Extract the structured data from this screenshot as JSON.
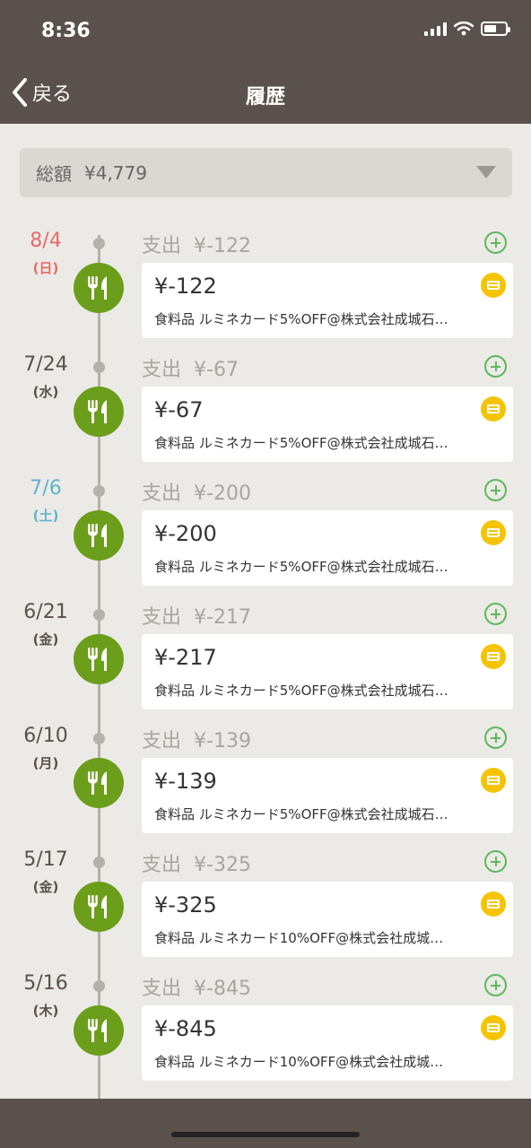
{
  "status_bar": {
    "time": "8:36"
  },
  "nav": {
    "back_label": "戻る",
    "title": "履歴"
  },
  "total": {
    "label": "総額",
    "amount": "¥4,779"
  },
  "entries": [
    {
      "date": "8/4",
      "weekday": "(日)",
      "day_type": "sun",
      "kind": "支出",
      "summary_amount": "¥-122",
      "amount": "¥-122",
      "description": "食料品 ルミネカード5%OFF@株式会社成城石…"
    },
    {
      "date": "7/24",
      "weekday": "(水)",
      "day_type": "",
      "kind": "支出",
      "summary_amount": "¥-67",
      "amount": "¥-67",
      "description": "食料品 ルミネカード5%OFF@株式会社成城石…"
    },
    {
      "date": "7/6",
      "weekday": "(土)",
      "day_type": "sat",
      "kind": "支出",
      "summary_amount": "¥-200",
      "amount": "¥-200",
      "description": "食料品 ルミネカード5%OFF@株式会社成城石…"
    },
    {
      "date": "6/21",
      "weekday": "(金)",
      "day_type": "",
      "kind": "支出",
      "summary_amount": "¥-217",
      "amount": "¥-217",
      "description": "食料品 ルミネカード5%OFF@株式会社成城石…"
    },
    {
      "date": "6/10",
      "weekday": "(月)",
      "day_type": "",
      "kind": "支出",
      "summary_amount": "¥-139",
      "amount": "¥-139",
      "description": "食料品 ルミネカード5%OFF@株式会社成城石…"
    },
    {
      "date": "5/17",
      "weekday": "(金)",
      "day_type": "",
      "kind": "支出",
      "summary_amount": "¥-325",
      "amount": "¥-325",
      "description": "食料品 ルミネカード10%OFF@株式会社成城…"
    },
    {
      "date": "5/16",
      "weekday": "(木)",
      "day_type": "",
      "kind": "支出",
      "summary_amount": "¥-845",
      "amount": "¥-845",
      "description": "食料品 ルミネカード10%OFF@株式会社成城…"
    }
  ],
  "colors": {
    "header": "#5b514c",
    "category_green": "#6b9e1a",
    "card_yellow": "#f5c400",
    "add_green": "#5cb85c",
    "sunday": "#e66b6b",
    "saturday": "#5fb4cc"
  },
  "icons": {
    "category": "fork-knife-icon",
    "payment": "credit-card-icon",
    "add": "plus-circle-icon"
  }
}
